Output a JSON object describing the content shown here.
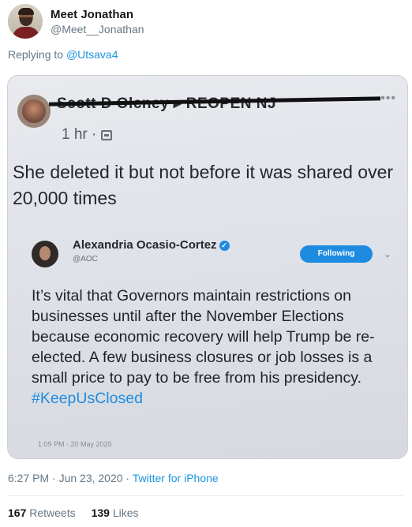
{
  "tweet": {
    "display_name": "Meet Jonathan",
    "handle": "@Meet__Jonathan",
    "replying_prefix": "Replying to",
    "replying_mention": "@Utsava4",
    "timestamp": "6:27 PM · Jun 23, 2020 · ",
    "source": "Twitter for iPhone",
    "retweets_count": "167",
    "retweets_label": "Retweets",
    "likes_count": "139",
    "likes_label": "Likes"
  },
  "screenshot": {
    "fb_name": "Scott D Olcney ▸ REOPEN NJ",
    "fb_time": "1 hr ·",
    "fb_more": "•••",
    "fb_text": "She deleted it but not before it was shared over 20,000 times",
    "aoc_name": "Alexandria Ocasio-Cortez",
    "aoc_handle": "@AOC",
    "follow_label": "Following",
    "aoc_text": "It’s vital that Governors maintain restrictions on businesses until after the November Elections because economic recovery will help Trump be re-elected. A few business closures or job losses is a small price to pay to be free from his presidency.",
    "aoc_hashtag": "#KeepUsClosed",
    "aoc_time": "1:09 PM · 20 May 2020"
  },
  "colors": {
    "link": "#1b95e0",
    "secondary_text": "#657786",
    "verified": "#1d8ce0"
  },
  "icons": [
    "avatar",
    "globe-icon",
    "verified-icon",
    "chevron-down-icon",
    "more-icon"
  ]
}
